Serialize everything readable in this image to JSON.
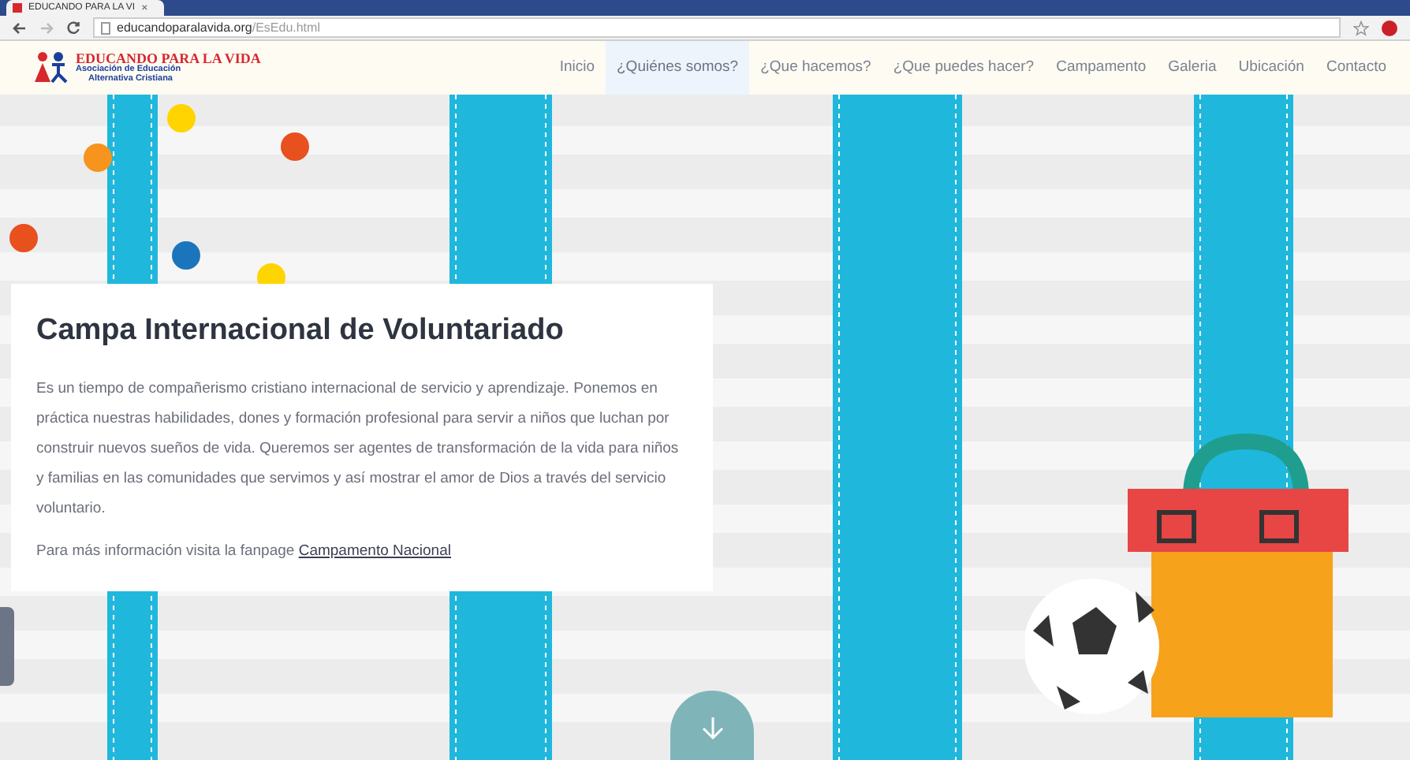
{
  "browser": {
    "tab_title": "EDUCANDO PARA LA VI",
    "tab_close": "×",
    "url_host": "educandoparalavida.org",
    "url_path": "/EsEdu.html"
  },
  "logo": {
    "title": "EDUCANDO PARA LA VIDA",
    "subtitle_1": "Asociación de Educación",
    "subtitle_2": "Alternativa Cristiana"
  },
  "nav": [
    {
      "label": "Inicio",
      "selected": false
    },
    {
      "label": "¿Quiénes somos?",
      "selected": true
    },
    {
      "label": "¿Que hacemos?",
      "selected": false
    },
    {
      "label": "¿Que puedes hacer?",
      "selected": false
    },
    {
      "label": "Campamento",
      "selected": false
    },
    {
      "label": "Galeria",
      "selected": false
    },
    {
      "label": "Ubicación",
      "selected": false
    },
    {
      "label": "Contacto",
      "selected": false
    }
  ],
  "hero": {
    "title": "Campa Internacional de Voluntariado",
    "body": "Es un tiempo de compañerismo cristiano internacional de servicio y aprendizaje. Ponemos en práctica nuestras habilidades, dones y formación profesional para servir a niños que luchan por construir nuevos sueños de vida. Queremos ser agentes de transformación de la vida para niños y familias en las comunidades que servimos y así mostrar el amor de Dios a través del servicio voluntario.",
    "more_text": "Para más información visita la fanpage",
    "more_link": "Campamento Nacional"
  }
}
